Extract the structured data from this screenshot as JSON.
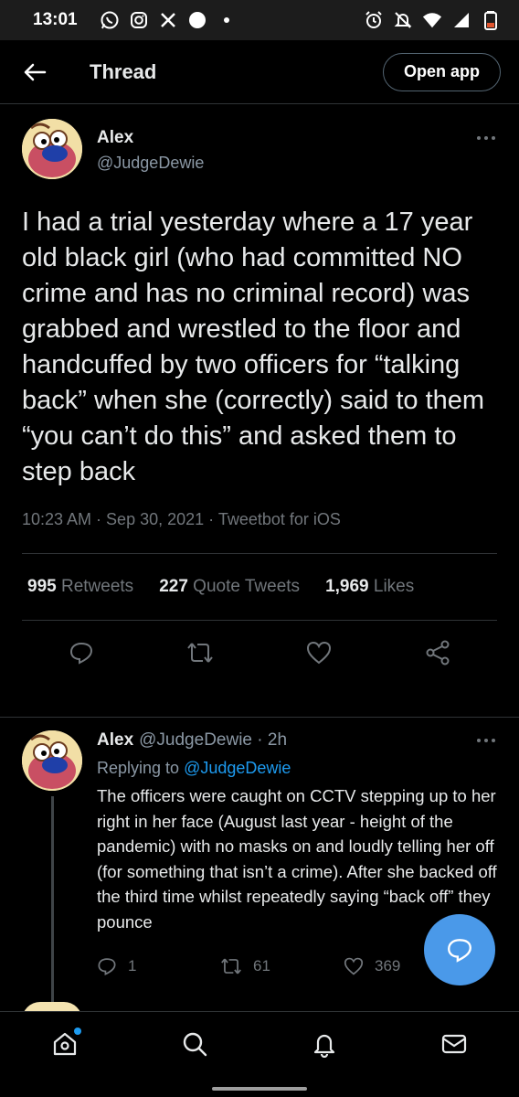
{
  "status_bar": {
    "time": "13:01"
  },
  "header": {
    "title": "Thread",
    "open_app_label": "Open app"
  },
  "main_tweet": {
    "author_name": "Alex",
    "author_handle": "@JudgeDewie",
    "text": "I had a trial yesterday where a 17 year old black girl (who had committed NO crime and has no criminal record) was grabbed and wrestled to the floor and handcuffed by two officers for “talking back” when she (correctly) said to them “you can’t do this” and asked them to step back",
    "meta": "10:23 AM · Sep 30, 2021 · Tweetbot for iOS",
    "stats": {
      "retweets_count": "995",
      "retweets_label": "Retweets",
      "quotes_count": "227",
      "quotes_label": "Quote Tweets",
      "likes_count": "1,969",
      "likes_label": "Likes"
    }
  },
  "reply": {
    "author_name": "Alex",
    "author_handle": "@JudgeDewie · 2h",
    "replying_prefix": "Replying to",
    "replying_to": "@JudgeDewie",
    "text": "The officers were caught on CCTV stepping up to her right in her face (August last year - height of the pandemic) with no masks on and loudly telling her off (for something that isn’t a crime). After she backed off the third time whilst repeatedly saying “back off” they pounce",
    "reply_count": "1",
    "retweet_count": "61",
    "like_count": "369"
  },
  "colors": {
    "accent": "#1d9bf0",
    "fab": "#4a99e9",
    "background": "#000000"
  }
}
